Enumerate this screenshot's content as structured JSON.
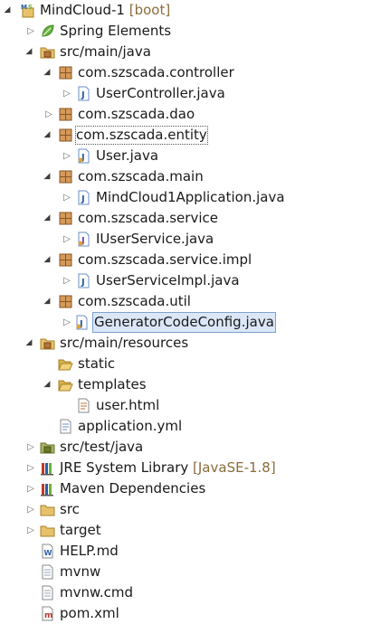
{
  "tree": {
    "project": {
      "name": "MindCloud-1",
      "decoration": "[boot]"
    },
    "items": [
      {
        "label": "Spring Elements"
      },
      {
        "label": "src/main/java"
      },
      {
        "label": "com.szscada.controller"
      },
      {
        "label": "UserController.java"
      },
      {
        "label": "com.szscada.dao"
      },
      {
        "label": "com.szscada.entity"
      },
      {
        "label": "User.java"
      },
      {
        "label": "com.szscada.main"
      },
      {
        "label": "MindCloud1Application.java"
      },
      {
        "label": "com.szscada.service"
      },
      {
        "label": "IUserService.java"
      },
      {
        "label": "com.szscada.service.impl"
      },
      {
        "label": "UserServiceImpl.java"
      },
      {
        "label": "com.szscada.util"
      },
      {
        "label": "GeneratorCodeConfig.java"
      },
      {
        "label": "src/main/resources"
      },
      {
        "label": "static"
      },
      {
        "label": "templates"
      },
      {
        "label": "user.html"
      },
      {
        "label": "application.yml"
      },
      {
        "label": "src/test/java"
      },
      {
        "label": "JRE System Library",
        "decoration": "[JavaSE-1.8]"
      },
      {
        "label": "Maven Dependencies"
      },
      {
        "label": "src"
      },
      {
        "label": "target"
      },
      {
        "label": "HELP.md"
      },
      {
        "label": "mvnw"
      },
      {
        "label": "mvnw.cmd"
      },
      {
        "label": "pom.xml"
      }
    ]
  },
  "colors": {
    "package": "#b8733a",
    "folder": "#d9b24c",
    "java_file": "#2b5ea8",
    "spring": "#6db33f",
    "selection": "#dbe7f7",
    "decoration": "#8a6d3b"
  }
}
